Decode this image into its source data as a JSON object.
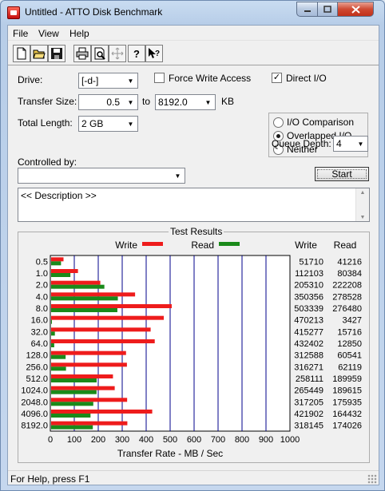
{
  "window": {
    "title": "Untitled - ATTO Disk Benchmark"
  },
  "menu": {
    "file": "File",
    "view": "View",
    "help": "Help"
  },
  "toolbar": {
    "icons": [
      "new-icon",
      "open-icon",
      "save-icon",
      "print-icon",
      "print-preview-icon",
      "move-icon",
      "help-icon",
      "context-help-icon"
    ]
  },
  "form": {
    "drive_label": "Drive:",
    "drive_value": "[-d-]",
    "force_write_label": "Force Write Access",
    "force_write_checked": false,
    "direct_io_label": "Direct I/O",
    "direct_io_checked": true,
    "transfer_size_label": "Transfer Size:",
    "transfer_from": "0.5",
    "to_label": "to",
    "transfer_to": "8192.0",
    "kb_label": "KB",
    "total_length_label": "Total Length:",
    "total_length_value": "2 GB",
    "io_options": [
      {
        "label": "I/O Comparison",
        "selected": false
      },
      {
        "label": "Overlapped I/O",
        "selected": true
      },
      {
        "label": "Neither",
        "selected": false
      }
    ],
    "queue_depth_label": "Queue Depth:",
    "queue_depth_value": "4",
    "controlled_by_label": "Controlled by:",
    "controlled_by_value": "",
    "start_label": "Start",
    "description": "<< Description >>"
  },
  "results": {
    "title": "Test Results",
    "legend_write": "Write",
    "legend_read": "Read",
    "col_write": "Write",
    "col_read": "Read",
    "colors": {
      "write": "#ee1c1c",
      "read": "#1a8a1a",
      "grid": "#00008b"
    }
  },
  "chart_data": {
    "type": "bar",
    "orientation": "horizontal",
    "xlabel": "Transfer Rate - MB / Sec",
    "xlim": [
      0,
      1000
    ],
    "xticks": [
      0,
      100,
      200,
      300,
      400,
      500,
      600,
      700,
      800,
      900,
      1000
    ],
    "categories": [
      "0.5",
      "1.0",
      "2.0",
      "4.0",
      "8.0",
      "16.0",
      "32.0",
      "64.0",
      "128.0",
      "256.0",
      "512.0",
      "1024.0",
      "2048.0",
      "4096.0",
      "8192.0"
    ],
    "series": [
      {
        "name": "Write",
        "values": [
          51.7,
          112.1,
          205.3,
          350.4,
          503.3,
          470.2,
          415.3,
          432.4,
          312.6,
          316.3,
          258.1,
          265.4,
          317.2,
          421.9,
          318.1
        ],
        "color": "#ee1c1c"
      },
      {
        "name": "Read",
        "values": [
          41.2,
          80.4,
          222.2,
          278.5,
          276.5,
          3.4,
          15.7,
          12.9,
          60.5,
          62.1,
          190.0,
          189.6,
          175.9,
          164.4,
          174.0
        ],
        "color": "#1a8a1a"
      }
    ],
    "table_write": [
      "51710",
      "112103",
      "205310",
      "350356",
      "503339",
      "470213",
      "415277",
      "432402",
      "312588",
      "316271",
      "258111",
      "265449",
      "317205",
      "421902",
      "318145"
    ],
    "table_read": [
      "41216",
      "80384",
      "222208",
      "278528",
      "276480",
      "3427",
      "15716",
      "12850",
      "60541",
      "62119",
      "189959",
      "189615",
      "175935",
      "164432",
      "174026"
    ]
  },
  "status": {
    "text": "For Help, press F1"
  }
}
